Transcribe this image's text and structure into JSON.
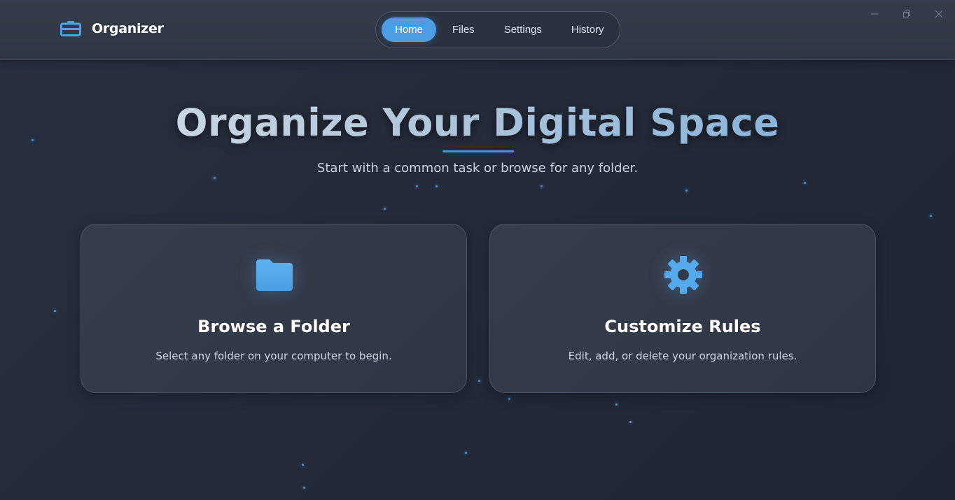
{
  "app": {
    "name": "Organizer",
    "brand_icon": "toolbox-icon",
    "accent_color": "#4b9ee3"
  },
  "nav": {
    "items": [
      {
        "label": "Home",
        "active": true
      },
      {
        "label": "Files",
        "active": false
      },
      {
        "label": "Settings",
        "active": false
      },
      {
        "label": "History",
        "active": false
      }
    ]
  },
  "window_controls": [
    "minimize-icon",
    "restore-icon",
    "close-icon"
  ],
  "hero": {
    "title": "Organize Your Digital Space",
    "subtitle": "Start with a common task or browse for any folder."
  },
  "cards": [
    {
      "icon": "folder-icon",
      "title": "Browse a Folder",
      "description": "Select any folder on your computer to begin."
    },
    {
      "icon": "gear-icon",
      "title": "Customize Rules",
      "description": "Edit, add, or delete your organization rules."
    }
  ]
}
